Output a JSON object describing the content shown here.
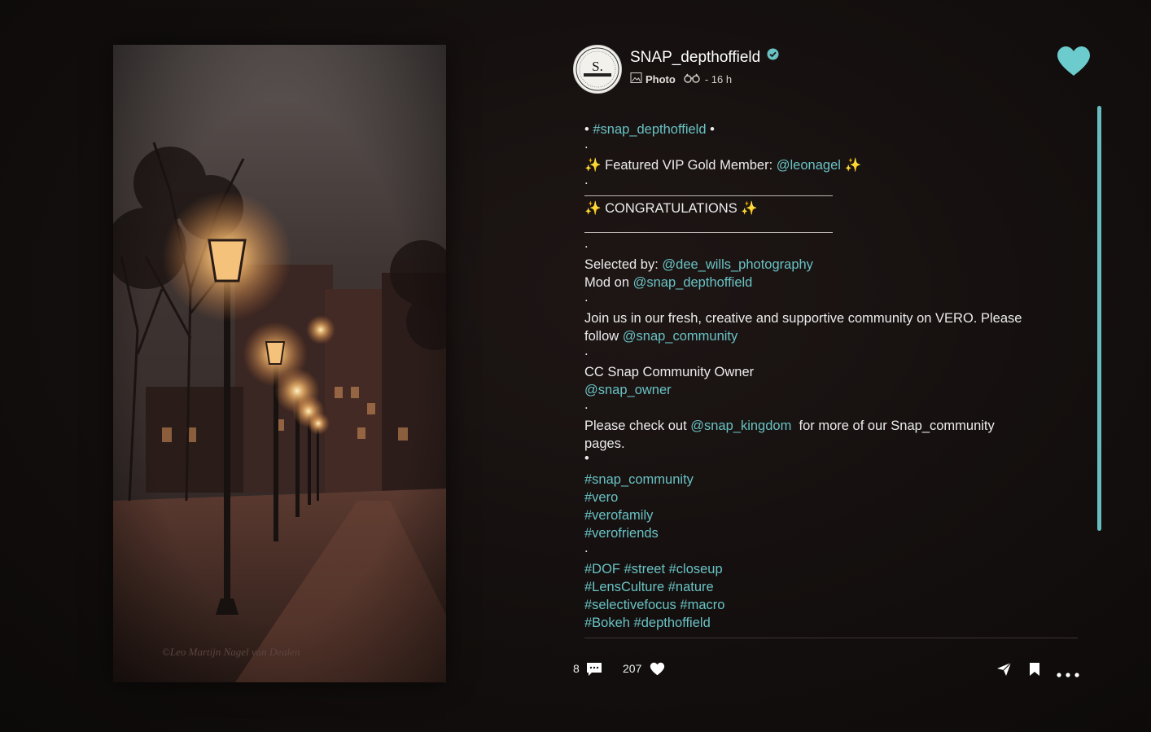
{
  "post": {
    "username": "SNAP_depthoffield",
    "type_label": "Photo",
    "time_ago": "- 16 h",
    "photo_watermark": "©Leo Martijn Nagel van Dealen",
    "avatar_letter": "S."
  },
  "caption": {
    "line1_prefix": "• ",
    "line1_tag": "#snap_depthoffield",
    "line1_suffix": " •",
    "dot1": ".",
    "featured_prefix": "✨ Featured VIP Gold Member: ",
    "featured_user": "@leonagel",
    "featured_suffix": " ✨",
    "dot2": ".",
    "congrats": "✨ CONGRATULATIONS ✨",
    "dot3": ".",
    "selected_prefix": "Selected by: ",
    "selected_user": "@dee_wills_photography",
    "mod_prefix": "Mod on ",
    "mod_user": "@snap_depthoffield",
    "dot4": ".",
    "join_text": "Join us in our fresh, creative and supportive community on VERO. Please",
    "follow_prefix": "follow ",
    "follow_user": "@snap_community",
    "dot5": ".",
    "owner_text": "CC Snap Community Owner",
    "owner_user": "@snap_owner",
    "dot6": ".",
    "check_prefix": "Please check out ",
    "check_user": "@snap_kingdom",
    "check_suffix": "  for more of our Snap_community",
    "check_line2": "pages.",
    "bullet": "•",
    "hashtags1": [
      "#snap_community",
      "#vero",
      "#verofamily",
      "#verofriends"
    ],
    "dot7": ".",
    "hashtags2": [
      "#DOF #street #closeup",
      "#LensCulture #nature",
      "#selectivefocus #macro",
      "#Bokeh #depthoffield"
    ]
  },
  "footer": {
    "comments_count": "8",
    "likes_count": "207"
  },
  "colors": {
    "accent": "#69c2c4",
    "heart": "#6ccbcd",
    "background": "#130f0e"
  },
  "icons": [
    "verified-icon",
    "photo-icon",
    "binoculars-icon",
    "heart-icon",
    "comment-icon",
    "send-icon",
    "bookmark-icon",
    "more-icon"
  ]
}
